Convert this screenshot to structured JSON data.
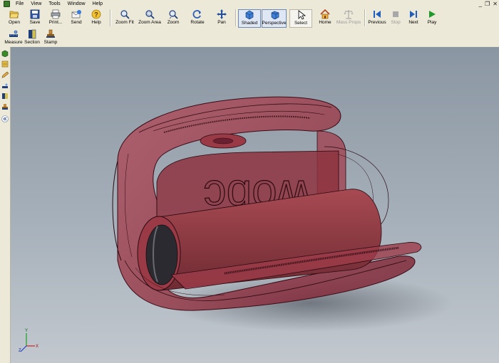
{
  "menu": [
    "File",
    "View",
    "Tools",
    "Window",
    "Help"
  ],
  "window_controls": {
    "minimize": "_",
    "restore": "❐",
    "close": "✕"
  },
  "toolbar": {
    "open": "Open",
    "save": "Save",
    "print": "Print...",
    "send": "Send",
    "help": "Help",
    "zoom_fit": "Zoom Fit",
    "zoom_area": "Zoom Area",
    "zoom": "Zoom",
    "rotate": "Rotate",
    "pan": "Pan",
    "shaded": "Shaded",
    "perspective": "Perspective",
    "select": "Select",
    "home": "Home",
    "mass_props": "Mass Props",
    "previous": "Previous",
    "stop": "Stop",
    "next": "Next",
    "play": "Play",
    "measure": "Measure",
    "section": "Section",
    "stamp": "Stamp"
  },
  "model": {
    "engraving": "wobc"
  },
  "triad": {
    "x": "X",
    "y": "Y",
    "z": "Z"
  },
  "colors": {
    "accent": "#316ac5",
    "model_red": "#9b3a48",
    "viewport_top": "#8a96a2",
    "viewport_bottom": "#c2c8ce"
  }
}
